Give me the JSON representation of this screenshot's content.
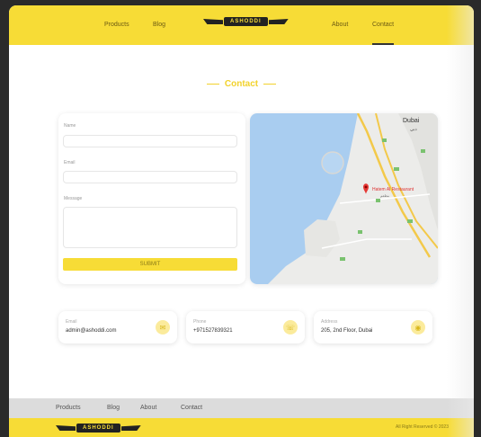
{
  "header": {
    "brand": "ASHODDI",
    "nav": {
      "products": "Products",
      "blog": "Blog",
      "about": "About",
      "contact": "Contact"
    },
    "accent": "#f7dc36"
  },
  "section": {
    "title": "Contact"
  },
  "form": {
    "name_label": "Name",
    "email_label": "Email",
    "message_label": "Message",
    "submit_label": "SUBMIT"
  },
  "map": {
    "city": "Dubai",
    "city_arabic": "دبي",
    "pin_label": "Hatem Al Restaurant",
    "pin_sublabel": "مطعم"
  },
  "info": {
    "email": {
      "label": "Email",
      "value": "admin@ashoddi.com",
      "icon": "envelope-icon"
    },
    "phone": {
      "label": "Phone",
      "value": "+971527839321",
      "icon": "phone-icon"
    },
    "address": {
      "label": "Address",
      "value": "205, 2nd Floor, Dubai",
      "icon": "location-icon"
    }
  },
  "footer": {
    "links": {
      "products": "Products",
      "blog": "Blog",
      "about": "About",
      "contact": "Contact"
    },
    "brand": "ASHODDI",
    "copyright": "All Right Reserved © 2023"
  }
}
